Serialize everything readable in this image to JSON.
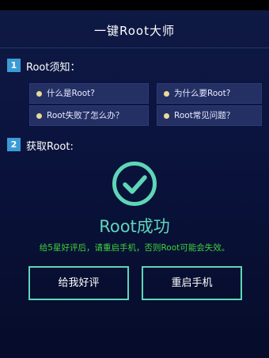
{
  "header": {
    "title": "一键Root大师"
  },
  "sections": [
    {
      "number": "1",
      "label": "Root须知："
    },
    {
      "number": "2",
      "label": "获取Root:"
    }
  ],
  "faq": [
    {
      "label": "什么是Root?"
    },
    {
      "label": "为什么要Root?"
    },
    {
      "label": "Root失败了怎么办？"
    },
    {
      "label": "Root常见问题？"
    }
  ],
  "result": {
    "status_icon": "check-circle-icon",
    "status_text": "Root成功",
    "notice": "给5星好评后，请重启手机，否则Root可能会失效。"
  },
  "actions": {
    "rate_label": "给我好评",
    "reboot_label": "重启手机"
  },
  "colors": {
    "accent": "#5fd6b6",
    "notice": "#3fd23b",
    "section_badge": "#3a9bd6",
    "item_bg": "#243064",
    "bullet": "#e6dc9a"
  }
}
